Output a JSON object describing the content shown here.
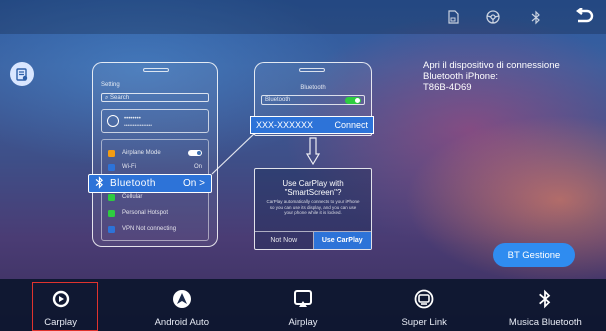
{
  "topbar": {
    "icons": [
      "sd-card-icon",
      "steering-wheel-icon",
      "bluetooth-icon",
      "back-icon"
    ]
  },
  "illustration": {
    "settings_title": "Setting",
    "search_placeholder": "Search",
    "profile_name": "••••••••",
    "profile_sub": "••••••••••••••••",
    "rows": [
      {
        "label": "Airplane Mode",
        "value": "",
        "color": "#f39c12",
        "toggle": true
      },
      {
        "label": "Wi-Fi",
        "value": "On",
        "color": "#2d73d8",
        "toggle": false
      },
      {
        "label": "Cellular",
        "value": "",
        "color": "#2ecc40",
        "toggle": false
      },
      {
        "label": "Personal Hotspot",
        "value": "",
        "color": "#2ecc40",
        "toggle": false
      },
      {
        "label": "VPN Not connecting",
        "value": "",
        "color": "#2d73d8",
        "toggle": false
      }
    ],
    "bluetooth_label": "Bluetooth",
    "bluetooth_value": "On >",
    "bt_screen_title": "Bluetooth",
    "bt_toggle_label": "Bluetooth",
    "device_name": "XXX-XXXXXX",
    "connect_label": "Connect",
    "dialog_title": "Use CarPlay with \"SmartScreen\"?",
    "dialog_body": "CarPlay automatically connects to your iPhone so you can use its display, and you can use your phone while it is locked.",
    "not_now_label": "Not Now",
    "use_carplay_label": "Use CarPlay"
  },
  "info": {
    "line1": "Apri il dispositivo di connessione",
    "line2": "Bluetooth iPhone:",
    "line3": "T86B-4D69"
  },
  "bt_button": {
    "label": "BT Gestione"
  },
  "nav": [
    {
      "label": "Carplay",
      "icon": "carplay-icon",
      "active": true
    },
    {
      "label": "Android Auto",
      "icon": "android-auto-icon",
      "active": false
    },
    {
      "label": "Airplay",
      "icon": "airplay-icon",
      "active": false
    },
    {
      "label": "Super Link",
      "icon": "super-link-icon",
      "active": false
    },
    {
      "label": "Musica Bluetooth",
      "icon": "bluetooth-music-icon",
      "active": false
    }
  ],
  "colors": {
    "accent_blue": "#2d73d8",
    "button_blue": "#2f8cf0",
    "active_outline": "#e0332e",
    "toggle_green": "#2ecc40"
  }
}
